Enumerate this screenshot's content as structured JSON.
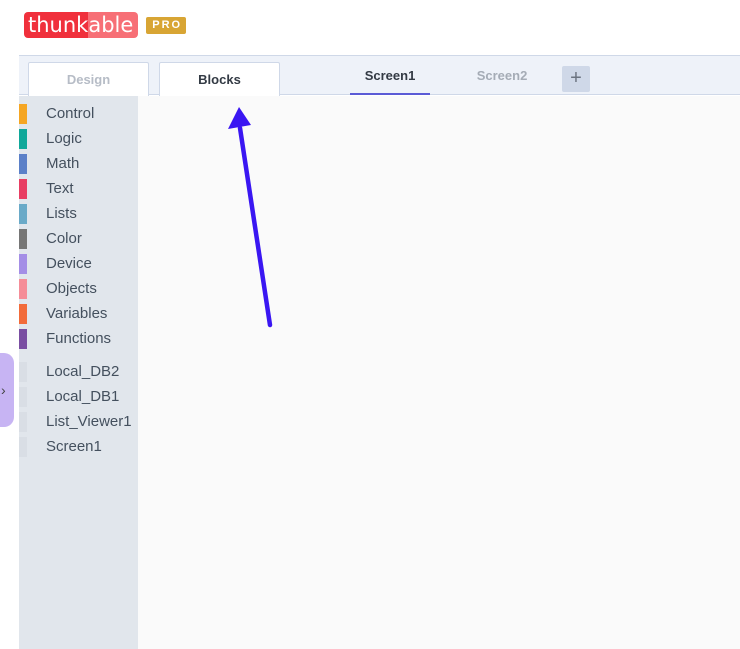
{
  "app": {
    "logo_text_a": "thunk",
    "logo_text_b": "able",
    "plan_badge": "PRO"
  },
  "mode_tabs": {
    "design": "Design",
    "blocks": "Blocks"
  },
  "screen_tabs": {
    "screen1": "Screen1",
    "screen2": "Screen2",
    "add_icon": "+"
  },
  "sidebar": {
    "categories": [
      {
        "label": "Control",
        "color": "#f5a623"
      },
      {
        "label": "Logic",
        "color": "#10a89a"
      },
      {
        "label": "Math",
        "color": "#5b80c8"
      },
      {
        "label": "Text",
        "color": "#e83e63"
      },
      {
        "label": "Lists",
        "color": "#6aaac8"
      },
      {
        "label": "Color",
        "color": "#767676"
      },
      {
        "label": "Device",
        "color": "#a48ee6"
      },
      {
        "label": "Objects",
        "color": "#f58d98"
      },
      {
        "label": "Variables",
        "color": "#f26b3a"
      },
      {
        "label": "Functions",
        "color": "#7a4ea2"
      }
    ],
    "components": [
      {
        "label": "Local_DB2",
        "color": "#d9dee5"
      },
      {
        "label": "Local_DB1",
        "color": "#d9dee5"
      },
      {
        "label": "List_Viewer1",
        "color": "#d9dee5"
      },
      {
        "label": "Screen1",
        "color": "#d9dee5"
      }
    ],
    "collapse_icon": "›"
  },
  "annotation": {
    "arrow_color": "#3a16f2"
  }
}
